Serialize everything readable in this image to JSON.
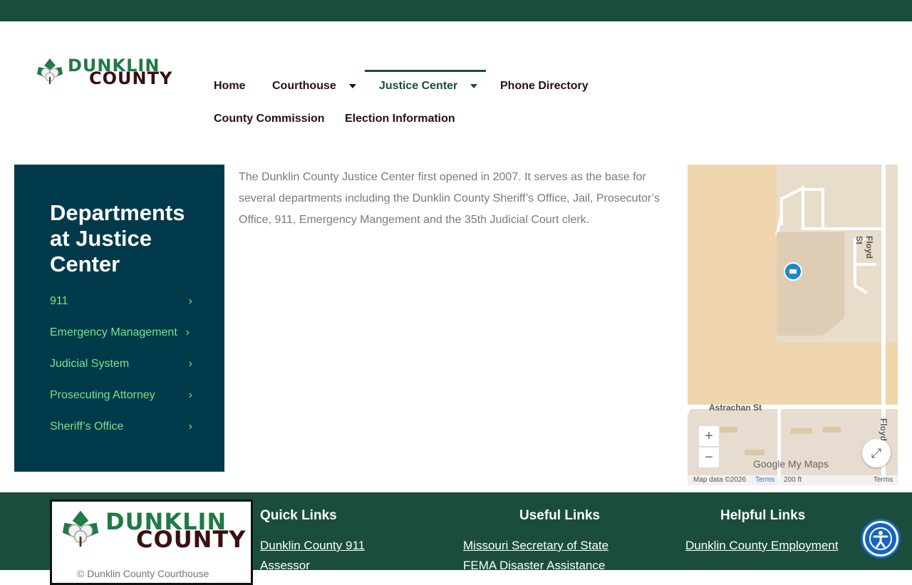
{
  "header": {
    "logo": {
      "line1": "DUNKLIN",
      "line2": "COUNTY"
    },
    "nav": [
      {
        "label": "Home",
        "has_dropdown": false
      },
      {
        "label": "Courthouse",
        "has_dropdown": true
      },
      {
        "label": "Justice Center",
        "has_dropdown": true,
        "active": true
      },
      {
        "label": "Phone Directory",
        "has_dropdown": false
      },
      {
        "label": "County Commission",
        "has_dropdown": false
      },
      {
        "label": "Election Information",
        "has_dropdown": false
      }
    ]
  },
  "sidebar": {
    "title": "Departments at Justice Center",
    "items": [
      {
        "label": "911"
      },
      {
        "label": "Emergency Management"
      },
      {
        "label": "Judicial System"
      },
      {
        "label": "Prosecuting Attorney"
      },
      {
        "label": "Sheriff’s Office"
      }
    ]
  },
  "main": {
    "text": "The Dunklin County Justice Center first opened in 2007. It serves as the base for several departments including the Dunklin County Sheriff’s Office, Jail, Prosecutor’s Office, 911, Emergency Mangement and the 35th Judicial Court clerk."
  },
  "map": {
    "street1": "Floyd St",
    "street2": "Astrachan St",
    "street3": "Floyd",
    "zoom_in": "+",
    "zoom_out": "−",
    "brand": "Google My Maps",
    "attribution": "Map data ©2026",
    "terms": "Terms",
    "scale": "200 ft",
    "terms2": "Terms"
  },
  "footer": {
    "logo": {
      "line1": "DUNKLIN",
      "line2": "COUNTY"
    },
    "copyright": "© Dunklin County Courthouse",
    "quick_links": {
      "title": "Quick Links",
      "items": [
        "Dunklin County 911",
        "Assessor"
      ]
    },
    "useful_links": {
      "title": "Useful Links",
      "items": [
        "Missouri Secretary of State",
        "FEMA Disaster Assistance"
      ]
    },
    "helpful_links": {
      "title": "Helpful Links",
      "items": [
        "Dunklin County Employment"
      ]
    }
  },
  "colors": {
    "brand_green": "#1a4d3c",
    "sidebar_bg": "#003a4a",
    "sidebar_link": "#7ee08a",
    "accessibility_blue": "#1565c0"
  }
}
